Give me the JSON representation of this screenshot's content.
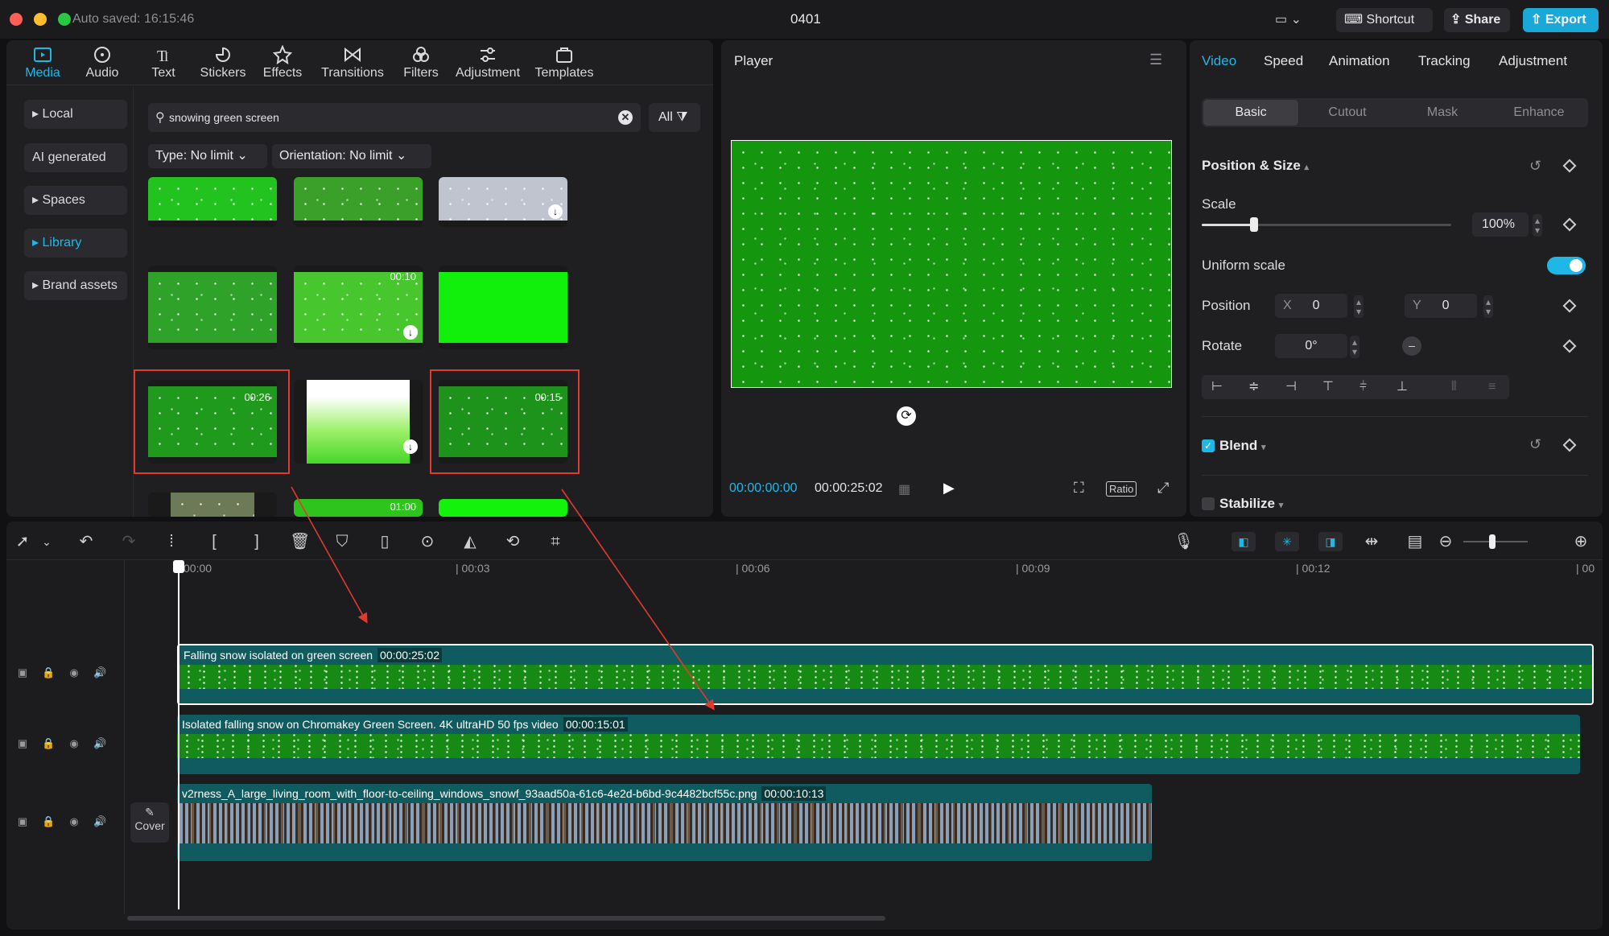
{
  "window": {
    "autosave": "Auto saved: 16:15:46",
    "title": "0401"
  },
  "topbar": {
    "shortcut": "Shortcut",
    "share": "Share",
    "export": "Export"
  },
  "toolbar": {
    "items": [
      {
        "label": "Media",
        "icon": "media-icon",
        "active": true
      },
      {
        "label": "Audio",
        "icon": "audio-icon"
      },
      {
        "label": "Text",
        "icon": "text-icon"
      },
      {
        "label": "Stickers",
        "icon": "stickers-icon"
      },
      {
        "label": "Effects",
        "icon": "effects-icon"
      },
      {
        "label": "Transitions",
        "icon": "transitions-icon"
      },
      {
        "label": "Filters",
        "icon": "filters-icon"
      },
      {
        "label": "Adjustment",
        "icon": "adjustment-icon"
      },
      {
        "label": "Templates",
        "icon": "templates-icon"
      }
    ]
  },
  "sidebar": {
    "items": [
      "Local",
      "AI generated",
      "Spaces",
      "Library",
      "Brand assets"
    ],
    "active": "Library"
  },
  "search": {
    "value": "snowing green screen",
    "filter": "All"
  },
  "filters": {
    "type": "Type: No limit",
    "orientation": "Orientation: No limit"
  },
  "media": {
    "d1": "00:10",
    "d2": "00:26",
    "d3": "00:15",
    "d4": "01:00"
  },
  "player": {
    "title": "Player",
    "current": "00:00:00:00",
    "total": "00:00:25:02",
    "ratio": "Ratio"
  },
  "inspector": {
    "tabs": [
      "Video",
      "Speed",
      "Animation",
      "Tracking",
      "Adjustment"
    ],
    "subtabs": [
      "Basic",
      "Cutout",
      "Mask",
      "Enhance"
    ],
    "section": "Position & Size",
    "scale_label": "Scale",
    "scale_value": "100%",
    "scale_fraction": 0.21,
    "uniform": "Uniform scale",
    "position_label": "Position",
    "x_label": "X",
    "x_value": "0",
    "y_label": "Y",
    "y_value": "0",
    "rotate_label": "Rotate",
    "rotate_value": "0°",
    "blend": "Blend",
    "stabilize": "Stabilize"
  },
  "timeline": {
    "ticks": [
      "00:00",
      "| 00:03",
      "| 00:06",
      "| 00:09",
      "| 00:12",
      "| 00"
    ],
    "cover": "Cover",
    "tracks": [
      {
        "title": "Falling snow isolated on green screen",
        "duration": "00:00:25:02"
      },
      {
        "title": "Isolated falling snow on Chromakey Green Screen. 4K ultraHD 50 fps video",
        "duration": "00:00:15:01"
      },
      {
        "title": "v2rness_A_large_living_room_with_floor-to-ceiling_windows_snowf_93aad50a-61c6-4e2d-b6bd-9c4482bcf55c.png",
        "duration": "00:00:10:13"
      }
    ]
  },
  "colors": {
    "accent": "#1fb8e6",
    "export": "#1aa8d8",
    "annotation": "#e03a2f",
    "green": "#229922"
  }
}
